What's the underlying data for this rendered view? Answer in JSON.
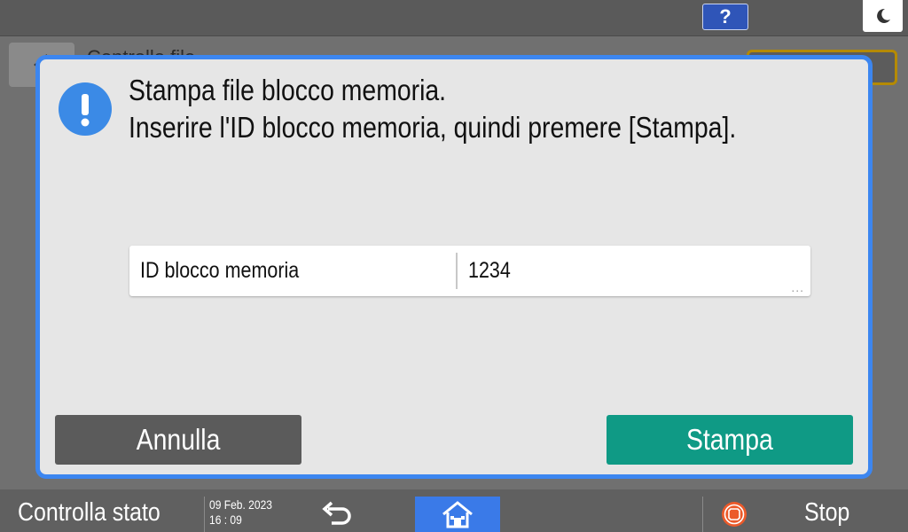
{
  "topbar": {
    "help_label": "?",
    "help_icon": "question-icon",
    "night_icon": "moon-icon"
  },
  "background": {
    "title": "Controllo file...",
    "back_icon": "arrow-left-icon"
  },
  "dialog": {
    "icon": "exclamation-icon",
    "message_line1": "Stampa file blocco memoria.",
    "message_line2": "Inserire l'ID blocco memoria, quindi premere [Stampa].",
    "field": {
      "label": "ID blocco memoria",
      "value": "1234",
      "more": "..."
    },
    "cancel_label": "Annulla",
    "print_label": "Stampa",
    "colors": {
      "border": "#3c86f0",
      "print_button": "#0f9a85",
      "cancel_button": "#5b5b5b"
    }
  },
  "bottombar": {
    "status_label": "Controlla stato",
    "date": "09 Feb. 2023",
    "time": "16 : 09",
    "back_icon": "undo-arrow-icon",
    "home_icon": "home-icon",
    "stop_icon": "stop-icon",
    "stop_label": "Stop"
  }
}
